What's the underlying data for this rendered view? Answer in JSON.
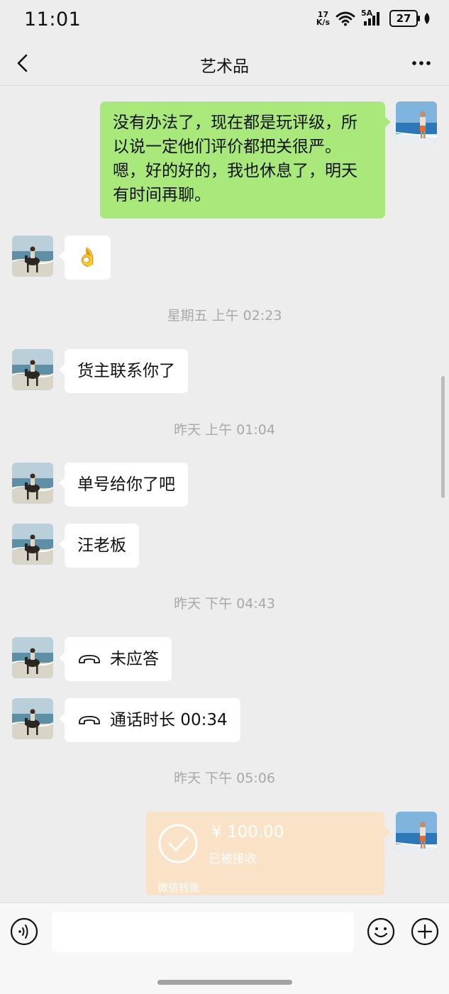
{
  "status_bar": {
    "time": "11:01",
    "net_speed_value": "17",
    "net_speed_unit": "K/s",
    "network_label": "5A",
    "battery": "27"
  },
  "header": {
    "title": "艺术品"
  },
  "messages": {
    "m1_line1": "没有办法了，现在都是玩评级，所",
    "m1_line2": "以说一定他们评价都把关很严。",
    "m1_line3": "嗯，好的好的，我也休息了，明天",
    "m1_line4": "有时间再聊。",
    "m2": "👌",
    "sep1": "星期五 上午 02:23",
    "m3": "货主联系你了",
    "sep2": "昨天 上午 01:04",
    "m4": "单号给你了吧",
    "m5": "汪老板",
    "sep3": "昨天 下午 04:43",
    "m6": "未应答",
    "m7": "通话时长 00:34",
    "sep4": "昨天 下午 05:06"
  },
  "transfer": {
    "amount": "¥ 100.00",
    "status": "已被接收",
    "label": "微信转账"
  },
  "colors": {
    "background": "#ededed",
    "outgoing_bubble": "#a9e87a",
    "incoming_bubble": "#ffffff",
    "transfer_card": "#f9e2c5"
  },
  "icons": {
    "back": "chevron-left-icon",
    "more": "more-dots-icon",
    "call": "phone-hangup-icon",
    "voice": "voice-icon",
    "emoji": "emoji-icon",
    "plus": "plus-icon"
  },
  "input": {
    "value": ""
  }
}
